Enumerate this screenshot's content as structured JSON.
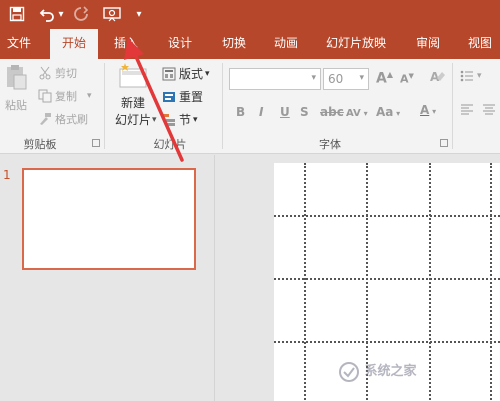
{
  "quick_access": {
    "save_icon": "save-icon",
    "undo_icon": "undo-icon",
    "undo_dropdown": "▾",
    "redo_icon": "redo-icon",
    "present_icon": "present-from-start-icon",
    "customize": "▾"
  },
  "tabs": [
    {
      "label": "文件",
      "active": false
    },
    {
      "label": "开始",
      "active": true
    },
    {
      "label": "插入",
      "active": false
    },
    {
      "label": "设计",
      "active": false
    },
    {
      "label": "切换",
      "active": false
    },
    {
      "label": "动画",
      "active": false
    },
    {
      "label": "幻灯片放映",
      "active": false
    },
    {
      "label": "审阅",
      "active": false
    },
    {
      "label": "视图",
      "active": false
    }
  ],
  "ribbon": {
    "clipboard": {
      "paste": "粘贴",
      "cut": "剪切",
      "copy": "复制",
      "format_painter": "格式刷",
      "group_label": "剪贴板"
    },
    "slides": {
      "new_slide_line1": "新建",
      "new_slide_line2": "幻灯片",
      "layout": "版式",
      "reset": "重置",
      "section": "节",
      "group_label": "幻灯片"
    },
    "font": {
      "font_name": "",
      "font_size": "60",
      "bold": "B",
      "italic": "I",
      "underline": "U",
      "strike": "S",
      "char_spacing": "AV",
      "change_case": "Aa",
      "grow": "A",
      "shrink": "A",
      "group_label": "字体"
    }
  },
  "slide_pane": {
    "slide_number": "1"
  },
  "colors": {
    "accent": "#b7472a",
    "ribbon_bg": "#f3f3f3",
    "annotation_arrow": "#e2383a"
  },
  "watermark": "系统之家"
}
